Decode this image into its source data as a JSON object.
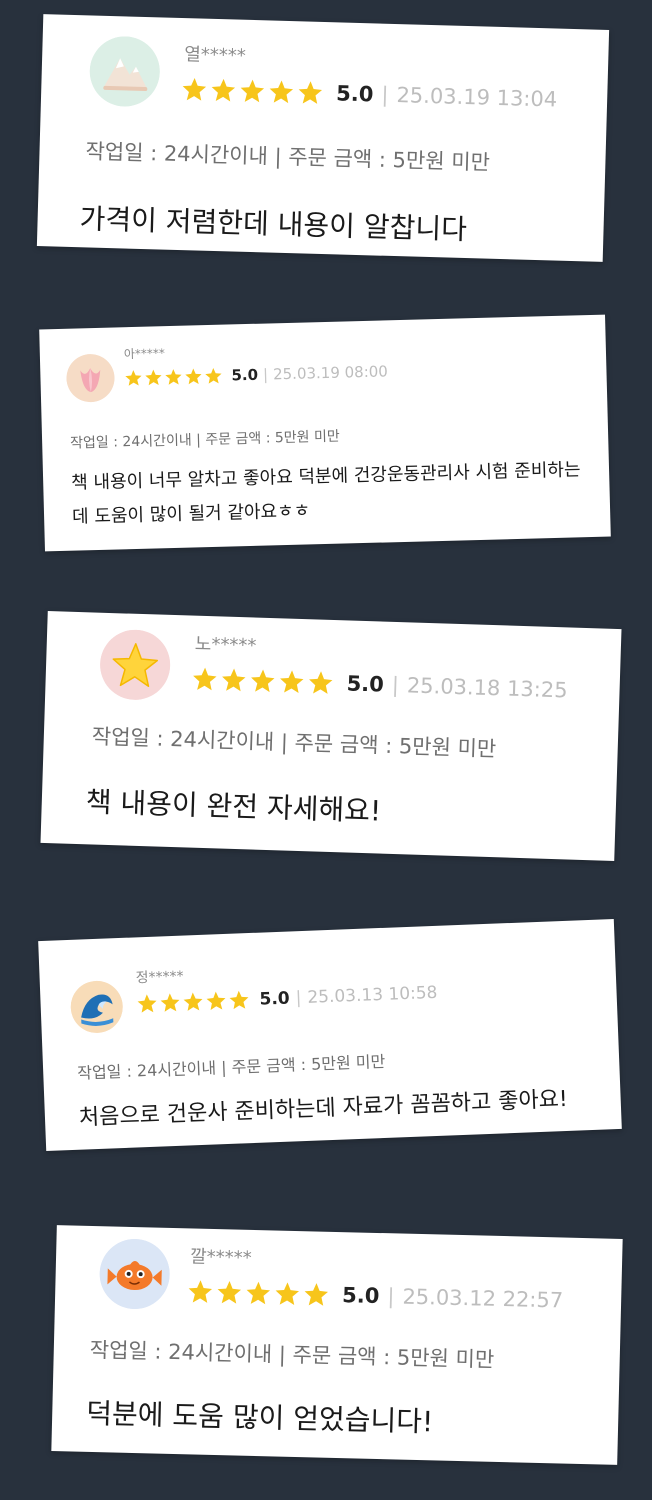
{
  "colors": {
    "background": "#28313d",
    "card": "#ffffff",
    "star": "#f7c51b",
    "date": "#bdbdbd",
    "meta": "#6f6f6f"
  },
  "reviews": [
    {
      "user": "열*****",
      "rating": "5.0",
      "stars": 5,
      "separator": "|",
      "date": "25.03.19 13:04",
      "meta": "작업일 : 24시간이내 | 주문 금액 : 5만원 미만",
      "text": "가격이 저렴한데 내용이 알찹니다",
      "avatar_icon": "mountain-icon"
    },
    {
      "user": "아*****",
      "rating": "5.0",
      "stars": 5,
      "separator": "|",
      "date": "25.03.19 08:00",
      "meta": "작업일 : 24시간이내 | 주문 금액 : 5만원 미만",
      "text": "책 내용이 너무 알차고 좋아요 덕분에 건강운동관리사 시험 준비하는데 도움이 많이 될거 같아요ㅎㅎ",
      "avatar_icon": "tulip-icon"
    },
    {
      "user": "노*****",
      "rating": "5.0",
      "stars": 5,
      "separator": "|",
      "date": "25.03.18 13:25",
      "meta": "작업일 : 24시간이내 | 주문 금액 : 5만원 미만",
      "text": "책 내용이 완전 자세해요!",
      "avatar_icon": "star-icon"
    },
    {
      "user": "정*****",
      "rating": "5.0",
      "stars": 5,
      "separator": "|",
      "date": "25.03.13 10:58",
      "meta": "작업일 : 24시간이내 | 주문 금액 : 5만원 미만",
      "text": "처음으로 건운사 준비하는데 자료가 꼼꼼하고 좋아요!",
      "avatar_icon": "wave-icon"
    },
    {
      "user": "깔*****",
      "rating": "5.0",
      "stars": 5,
      "separator": "|",
      "date": "25.03.12 22:57",
      "meta": "작업일 : 24시간이내 | 주문 금액 : 5만원 미만",
      "text": "덕분에 도움 많이 얻었습니다!",
      "avatar_icon": "fish-icon"
    }
  ]
}
